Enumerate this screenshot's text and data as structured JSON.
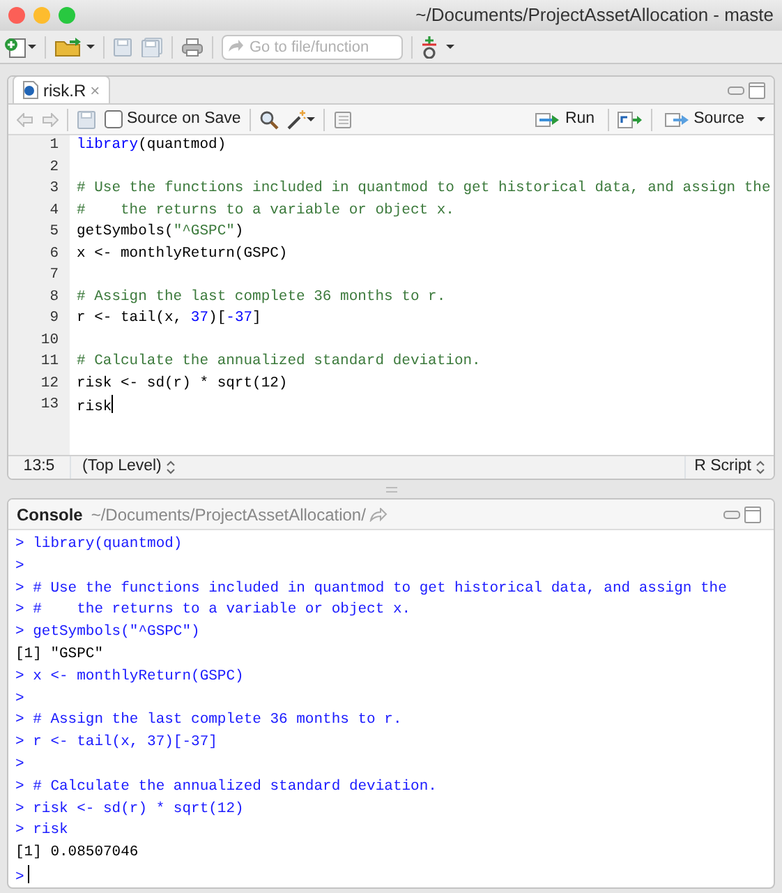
{
  "window": {
    "title": "~/Documents/ProjectAssetAllocation - maste"
  },
  "toolbar": {
    "goto_placeholder": "Go to file/function"
  },
  "editor": {
    "tab": {
      "label": "risk.R",
      "close": "×",
      "selected": true
    },
    "source_on_save": {
      "label": "Source on Save",
      "checked": false
    },
    "run_label": "Run",
    "source_label": "Source",
    "lines": [
      {
        "number": "1",
        "tokens": [
          {
            "text": "library",
            "kind": "keyword"
          },
          {
            "text": "(quantmod)",
            "kind": "plain"
          }
        ]
      },
      {
        "number": "2"
      },
      {
        "number": "3",
        "tokens": [
          {
            "text": "# Use the functions included in quantmod to get historical data, and assign the",
            "kind": "comment"
          }
        ]
      },
      {
        "number": "4",
        "tokens": [
          {
            "text": "#    the returns to a variable or object x.",
            "kind": "comment"
          }
        ]
      },
      {
        "number": "5",
        "tokens": [
          {
            "text": "getSymbols(",
            "kind": "plain"
          },
          {
            "text": "\"^GSPC\"",
            "kind": "string"
          },
          {
            "text": ")",
            "kind": "plain"
          }
        ]
      },
      {
        "number": "6",
        "tokens": [
          {
            "text": "x <- monthlyReturn(GSPC)",
            "kind": "plain"
          }
        ]
      },
      {
        "number": "7"
      },
      {
        "number": "8",
        "tokens": [
          {
            "text": "# Assign the last complete 36 months to r.",
            "kind": "comment"
          }
        ]
      },
      {
        "number": "9",
        "tokens": [
          {
            "text": "r <- tail(x, ",
            "kind": "plain"
          },
          {
            "text": "37",
            "kind": "number"
          },
          {
            "text": ")[",
            "kind": "plain"
          },
          {
            "text": "-37",
            "kind": "number"
          },
          {
            "text": "]",
            "kind": "plain"
          }
        ]
      },
      {
        "number": "10"
      },
      {
        "number": "11",
        "tokens": [
          {
            "text": "# Calculate the annualized standard deviation.",
            "kind": "comment"
          }
        ]
      },
      {
        "number": "12",
        "tokens": [
          {
            "text": "risk <- sd(r) * sqrt(12)",
            "kind": "plain"
          }
        ]
      },
      {
        "number": "13",
        "tokens": [
          {
            "text": "risk",
            "kind": "plain"
          }
        ],
        "cursor": true
      }
    ],
    "status": {
      "position": "13:5",
      "scope": "(Top Level)",
      "file_type": "R Script"
    }
  },
  "console": {
    "title": "Console",
    "path": "~/Documents/ProjectAssetAllocation/",
    "lines": [
      {
        "kind": "input",
        "prompt": ">",
        "text": "library(quantmod)"
      },
      {
        "kind": "input",
        "prompt": ">"
      },
      {
        "kind": "input",
        "prompt": ">",
        "text": "# Use the functions included in quantmod to get historical data, and assign the"
      },
      {
        "kind": "input",
        "prompt": ">",
        "text": "#    the returns to a variable or object x."
      },
      {
        "kind": "input",
        "prompt": ">",
        "text": "getSymbols(\"^GSPC\")"
      },
      {
        "kind": "output",
        "text": "[1] \"GSPC\""
      },
      {
        "kind": "input",
        "prompt": ">",
        "text": "x <- monthlyReturn(GSPC)"
      },
      {
        "kind": "input",
        "prompt": ">"
      },
      {
        "kind": "input",
        "prompt": ">",
        "text": "# Assign the last complete 36 months to r."
      },
      {
        "kind": "input",
        "prompt": ">",
        "text": "r <- tail(x, 37)[-37]"
      },
      {
        "kind": "input",
        "prompt": ">"
      },
      {
        "kind": "input",
        "prompt": ">",
        "text": "# Calculate the annualized standard deviation."
      },
      {
        "kind": "input",
        "prompt": ">",
        "text": "risk <- sd(r) * sqrt(12)"
      },
      {
        "kind": "input",
        "prompt": ">",
        "text": "risk"
      },
      {
        "kind": "output",
        "text": "[1] 0.08507046"
      },
      {
        "kind": "input",
        "prompt": ">",
        "cursor": true
      }
    ]
  }
}
